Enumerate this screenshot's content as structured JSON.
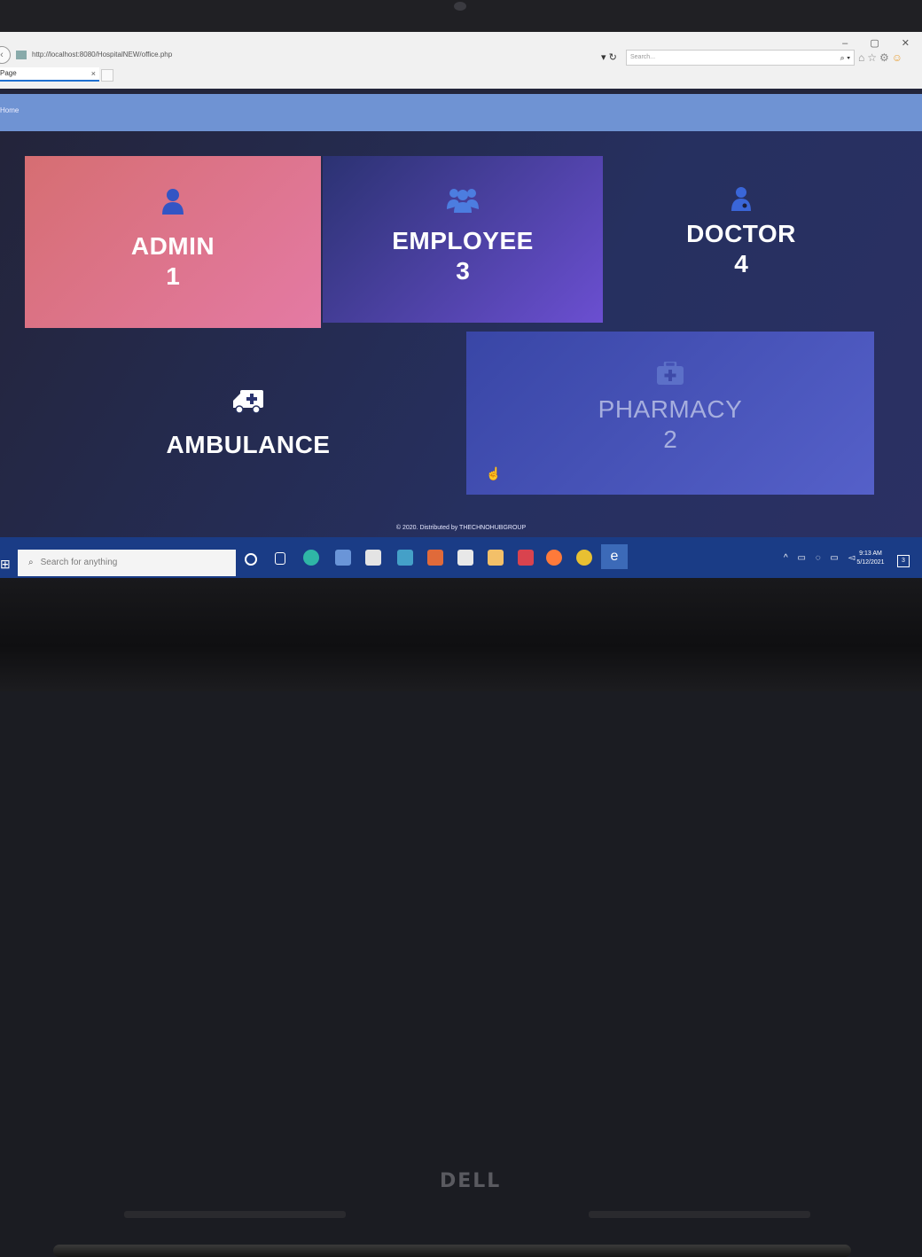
{
  "browser": {
    "address": "http://localhost:8080/HospitalNEW/office.php",
    "search_placeholder": "Search...",
    "tab_title": "Page",
    "tab_close": "×"
  },
  "navbar": {
    "home": "Home"
  },
  "tiles": {
    "admin": {
      "name": "ADMIN",
      "count": "1",
      "icon": "user-icon"
    },
    "employee": {
      "name": "EMPLOYEE",
      "count": "3",
      "icon": "users-icon"
    },
    "doctor": {
      "name": "DOCTOR",
      "count": "4",
      "icon": "user-doctor-icon"
    },
    "ambulance": {
      "name": "AMBULANCE",
      "icon": "ambulance-icon"
    },
    "pharmacy": {
      "name": "PHARMACY",
      "count": "2",
      "icon": "medkit-icon"
    }
  },
  "footer": {
    "text": "© 2020. Distributed by THECHNOHUBGROUP"
  },
  "taskbar": {
    "search_placeholder": "Search for anything",
    "time": "9:13 AM",
    "date": "5/12/2021"
  },
  "colors": {
    "admin_tile": "#d66e72",
    "employee_tile": "#4a3fa8",
    "pharmacy_tile": "#4653b8",
    "navbar": "#6f93d3",
    "taskbar": "#1a3c86"
  }
}
